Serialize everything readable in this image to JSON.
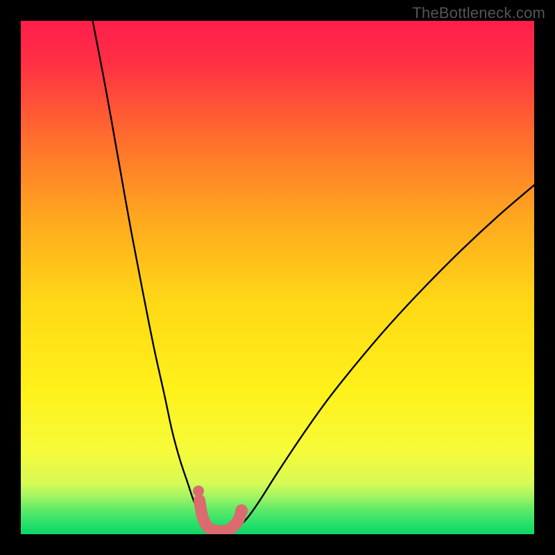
{
  "watermark": "TheBottleneck.com",
  "chart_data": {
    "type": "line",
    "title": "",
    "xlabel": "",
    "ylabel": "",
    "xlim": [
      0,
      100
    ],
    "ylim": [
      0,
      100
    ],
    "background_gradient": {
      "top": "#ff1e4b",
      "middle": "#ffe100",
      "bottom": "#11e06b"
    },
    "green_zone_top_fraction_from_bottom": 0.075,
    "series": [
      {
        "name": "left-branch-curve",
        "color": "#000000",
        "x": [
          14.0,
          16.5,
          19.0,
          21.5,
          24.0,
          26.0,
          28.0,
          29.5,
          31.0,
          32.5,
          33.5,
          34.5,
          35.2,
          35.8
        ],
        "y": [
          100.0,
          87.0,
          73.0,
          59.0,
          46.0,
          36.0,
          27.0,
          20.0,
          14.5,
          10.0,
          7.0,
          4.5,
          2.8,
          1.6
        ]
      },
      {
        "name": "right-branch-curve",
        "color": "#000000",
        "x": [
          42.5,
          44.0,
          46.5,
          50.0,
          55.0,
          60.0,
          66.0,
          72.0,
          79.0,
          86.0,
          93.0,
          100.0
        ],
        "y": [
          1.6,
          3.0,
          6.5,
          12.0,
          19.5,
          26.5,
          34.0,
          41.0,
          48.5,
          55.5,
          62.0,
          68.0
        ]
      },
      {
        "name": "flat-bottom-curve",
        "color": "#000000",
        "x": [
          35.8,
          36.8,
          38.0,
          39.2,
          40.5,
          41.5,
          42.5
        ],
        "y": [
          1.6,
          0.7,
          0.3,
          0.3,
          0.4,
          0.8,
          1.6
        ]
      },
      {
        "name": "highlight-segment",
        "color": "#db6b6f",
        "points": [
          {
            "x": 34.8,
            "y": 6.6
          },
          {
            "x": 35.4,
            "y": 3.4
          },
          {
            "x": 36.4,
            "y": 1.4
          },
          {
            "x": 37.6,
            "y": 0.8
          },
          {
            "x": 39.0,
            "y": 0.6
          },
          {
            "x": 40.3,
            "y": 0.8
          },
          {
            "x": 41.6,
            "y": 1.7
          },
          {
            "x": 42.5,
            "y": 3.0
          },
          {
            "x": 43.0,
            "y": 4.6
          }
        ]
      }
    ],
    "notes": "V-shaped bottleneck curve on a red-yellow-green vertical gradient. Minimum sits near x≈39, y≈0. A thick salmon overlay marks the near-optimal region around the trough. Axes have no ticks or labels."
  }
}
